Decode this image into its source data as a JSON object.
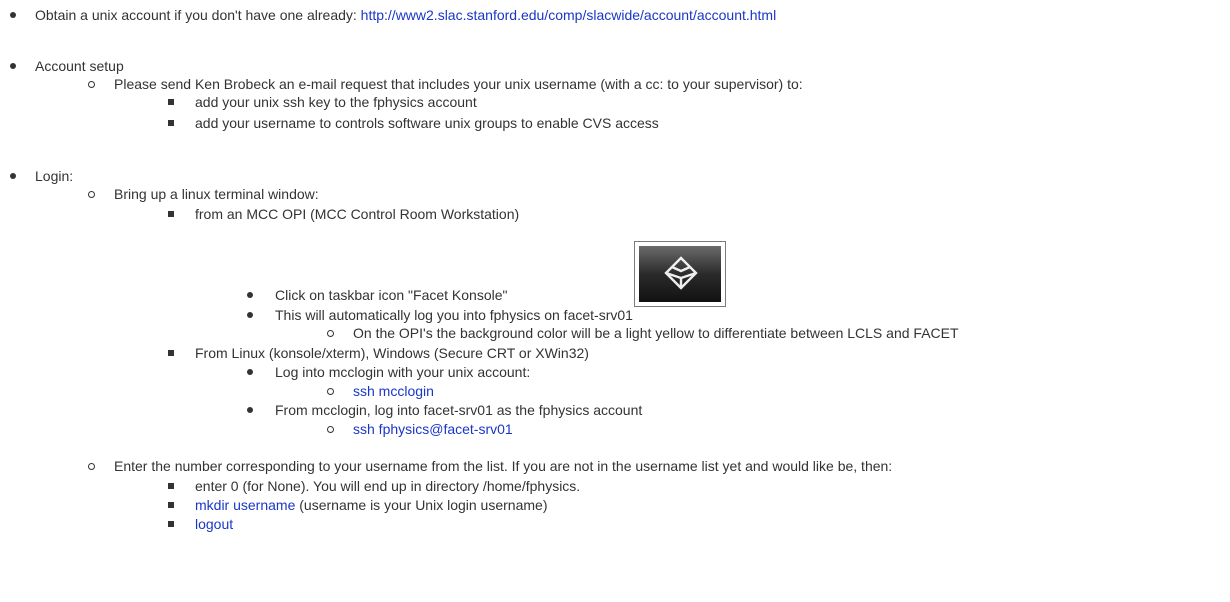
{
  "items": {
    "obtain_text": "Obtain a unix account if you don't have one already: ",
    "obtain_link": "http://www2.slac.stanford.edu/comp/slacwide/account/account.html",
    "account_setup": "Account setup",
    "send_request": "Please send Ken Brobeck an e-mail request that includes your unix username (with a cc: to your supervisor) to:",
    "add_ssh_key": "add your unix ssh key to the fphysics account",
    "add_username": "add your username to controls software unix groups to enable CVS access",
    "login": "Login:",
    "bring_up": "Bring up a linux terminal window:",
    "from_mcc": "from an MCC OPI  (MCC Control Room Workstation)",
    "click_taskbar": "Click on taskbar icon \"Facet Konsole\"",
    "auto_login": "This will automatically log you into fphysics on facet-srv01",
    "background_color": "On the OPI's the background color will be a light yellow to differentiate between LCLS and FACET",
    "from_linux": "From Linux (konsole/xterm), Windows (Secure CRT or XWin32)",
    "log_mcclogin": "Log into mcclogin with your unix account:",
    "ssh_mcclogin": "ssh mcclogin",
    "from_mcclogin": "From mcclogin, log into facet-srv01 as the fphysics account",
    "ssh_fphysics": "ssh fphysics@facet-srv01",
    "enter_number": "Enter the number corresponding to your username from the list. If you are not in the username list yet and would like be, then:",
    "enter_zero": "enter 0 (for None). You will end up in directory /home/fphysics.",
    "mkdir_link": "mkdir username",
    "mkdir_rest": " (username is your Unix login username)",
    "logout": "logout"
  },
  "icon": {
    "name": "facet-konsole-icon"
  }
}
